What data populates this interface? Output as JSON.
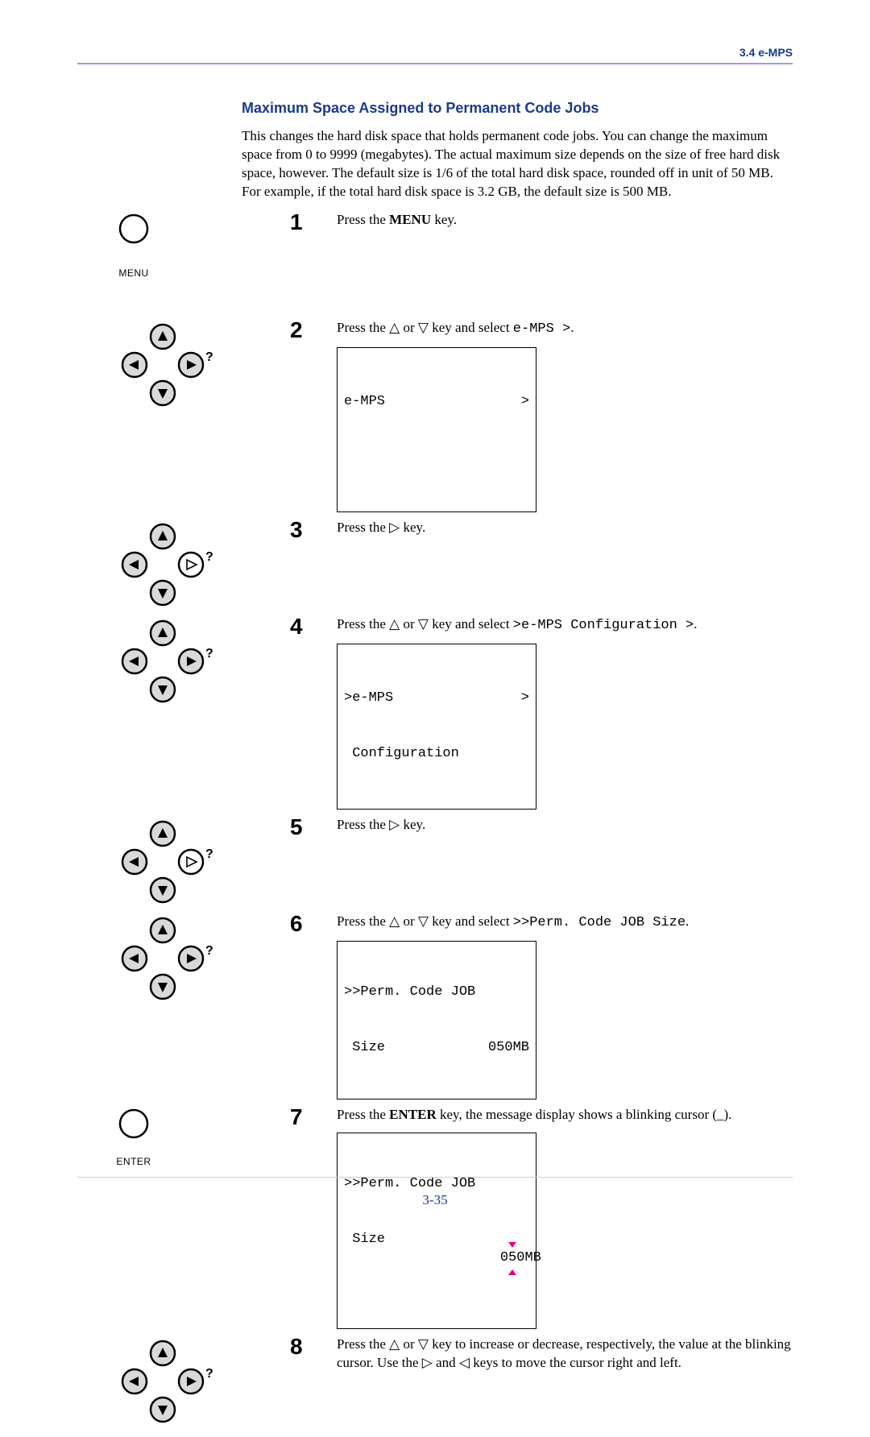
{
  "header": {
    "section": "3.4 e-MPS"
  },
  "title": "Maximum Space Assigned to Permanent Code Jobs",
  "intro": "This changes the hard disk space that holds permanent code jobs. You can change the maximum space from 0 to 9999 (megabytes). The actual maximum size depends on the size of free hard disk space, however.  The default size is 1/6 of the total hard disk space, rounded off in unit of 50 MB. For example, if the total hard disk space is 3.2 GB, the default size is 500 MB.",
  "steps": {
    "s1": {
      "num": "1",
      "text_a": "Press the ",
      "key": "MENU",
      "text_b": " key.",
      "icon_label": "MENU"
    },
    "s2": {
      "num": "2",
      "text_a": "Press the ",
      "tri1": "△",
      "mid": " or ",
      "tri2": "▽",
      "text_b": " key and select ",
      "mono": "e-MPS >",
      "text_c": ".",
      "display_l1_left": "e-MPS",
      "display_l1_right": ">"
    },
    "s3": {
      "num": "3",
      "text_a": "Press the ",
      "tri": "▷",
      "text_b": " key."
    },
    "s4": {
      "num": "4",
      "text_a": "Press the ",
      "tri1": "△",
      "mid": " or ",
      "tri2": "▽",
      "text_b": " key and select ",
      "mono": ">e-MPS Configuration >",
      "text_c": ".",
      "display_l1_left": ">e-MPS",
      "display_l1_right": ">",
      "display_l2": " Configuration"
    },
    "s5": {
      "num": "5",
      "text_a": "Press the ",
      "tri": "▷",
      "text_b": " key."
    },
    "s6": {
      "num": "6",
      "text_a": "Press the ",
      "tri1": "△",
      "mid": " or ",
      "tri2": "▽",
      "text_b": " key and select ",
      "mono": ">>Perm. Code JOB Size",
      "text_c": ".",
      "display_l1": ">>Perm. Code JOB",
      "display_l2_left": " Size",
      "display_l2_right": "050MB"
    },
    "s7": {
      "num": "7",
      "text_a": "Press the ",
      "key": "ENTER",
      "text_b": " key, the message display shows a blinking cursor (_).",
      "icon_label": "ENTER",
      "display_l1": ">>Perm. Code JOB",
      "display_l2_left": " Size",
      "display_l2_right_a": "0",
      "display_l2_right_b": "5",
      "display_l2_right_c": "0MB"
    },
    "s8": {
      "num": "8",
      "text_a": "Press the ",
      "tri1": "△",
      "mid": " or ",
      "tri2": "▽",
      "text_b": " key to increase or decrease, respectively, the value at the blinking cursor. Use the ",
      "tri3": "▷",
      "mid2": " and ",
      "tri4": "◁",
      "text_c": " keys to move the cursor right and left."
    }
  },
  "pageno": "3-35"
}
